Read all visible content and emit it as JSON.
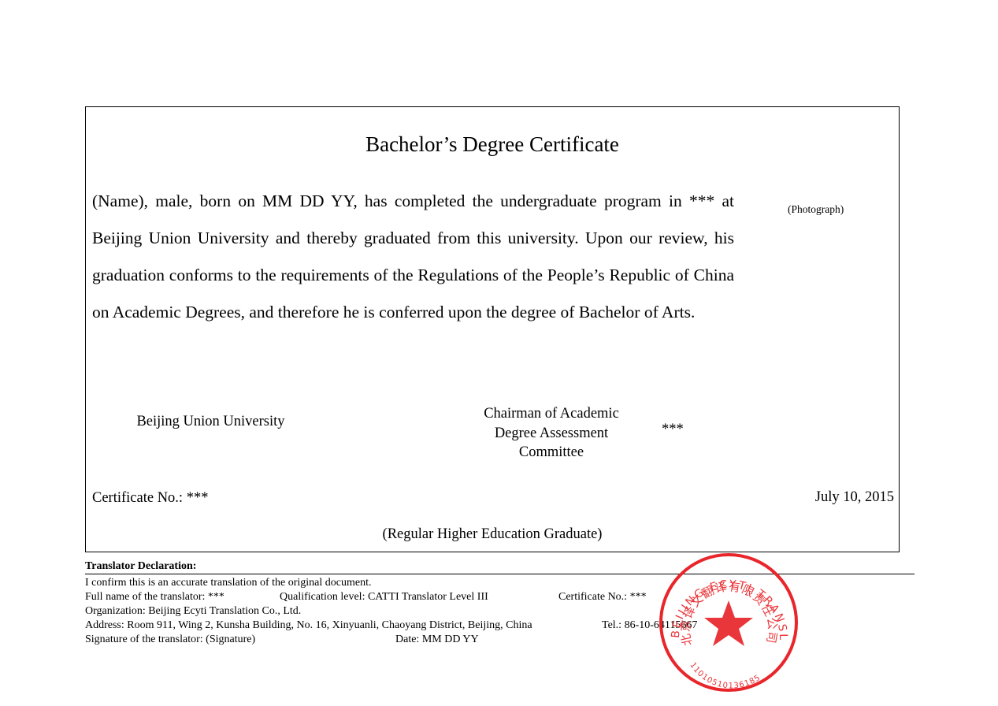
{
  "certificate": {
    "title": "Bachelor’s Degree Certificate",
    "body": "(Name), male, born on MM DD YY, has completed the undergraduate program in *** at Beijing Union University and thereby graduated from this university. Upon our review, his graduation conforms to the requirements of the Regulations of the People’s Republic of China on Academic Degrees, and therefore he is conferred upon the degree of Bachelor of Arts.",
    "photo": "(Photograph)",
    "university": "Beijing Union University",
    "chairman": "Chairman of Academic Degree Assessment Committee",
    "chairman_name": "***",
    "cert_no": "Certificate No.: ***",
    "date": "July 10, 2015",
    "footer": "(Regular Higher Education Graduate)"
  },
  "declaration": {
    "heading": "Translator Declaration:",
    "line1": "I confirm this is an accurate translation of the original document.",
    "name": "Full name of the translator: ***",
    "qualification": "Qualification level: CATTI Translator Level III",
    "cert_no": "Certificate No.: ***",
    "organization": "Organization: Beijing Ecyti Translation Co., Ltd.",
    "address": "Address: Room 911, Wing 2, Kunsha Building, No. 16, Xinyuanli, Chaoyang District, Beijing, China",
    "tel": "Tel.: 86-10-64115667",
    "signature": "Signature of the translator: (Signature)",
    "date": "Date: MM DD YY"
  },
  "stamp": {
    "outer_text": "BEIJING ECYTI TRANSLATION CO., LTD.",
    "inner_text": "北京译文翻译有限责任公司",
    "number": "110105101361​85",
    "color": "#e8262b"
  }
}
